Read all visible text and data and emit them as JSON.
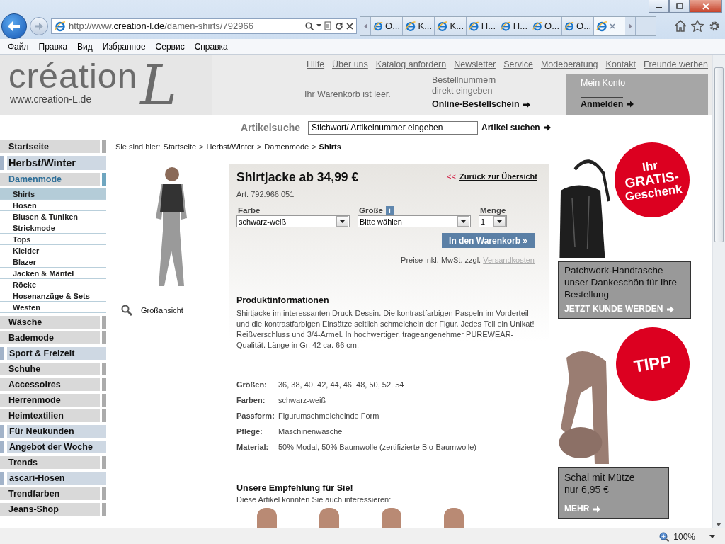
{
  "browser": {
    "url_parts": [
      {
        "text": "http://www.",
        "strong": false
      },
      {
        "text": "creation-l.de",
        "strong": true
      },
      {
        "text": "/damen-shirts/792966",
        "strong": false
      }
    ],
    "tabs": [
      {
        "label": "O...",
        "selected": false
      },
      {
        "label": "K...",
        "selected": false
      },
      {
        "label": "K...",
        "selected": false
      },
      {
        "label": "H...",
        "selected": false
      },
      {
        "label": "H...",
        "selected": false
      },
      {
        "label": "O...",
        "selected": false
      },
      {
        "label": "O...",
        "selected": false
      },
      {
        "selected": true
      }
    ],
    "menu": [
      "Файл",
      "Правка",
      "Вид",
      "Избранное",
      "Сервис",
      "Справка"
    ]
  },
  "header": {
    "logo": {
      "word": "création",
      "letter": "L",
      "url": "www.creation-L.de"
    },
    "links": [
      "Hilfe",
      "Über uns",
      "Katalog anfordern",
      "Newsletter",
      "Service",
      "Modeberatung",
      "Kontakt",
      "Freunde werben"
    ],
    "cart": "Ihr Warenkorb ist leer.",
    "order": {
      "lines": [
        "Bestellnummern",
        "direkt eingeben"
      ],
      "link": "Online-Bestellschein"
    },
    "account": {
      "title": "Mein Konto",
      "link": "Anmelden"
    }
  },
  "search": {
    "label": "Artikelsuche",
    "value": "Stichwort/ Artikelnummer eingeben",
    "button": "Artikel suchen"
  },
  "nav": [
    {
      "label": "Startseite",
      "kind": "main"
    },
    {
      "label": "Herbst/Winter",
      "kind": "season",
      "children": [
        {
          "label": "Damenmode",
          "kind": "category",
          "children": [
            {
              "label": "Shirts",
              "selected": true
            },
            {
              "label": "Hosen",
              "selected": false
            },
            {
              "label": "Blusen & Tuniken",
              "selected": false
            },
            {
              "label": "Strickmode",
              "selected": false
            },
            {
              "label": "Tops",
              "selected": false
            },
            {
              "label": "Kleider",
              "selected": false
            },
            {
              "label": "Blazer",
              "selected": false
            },
            {
              "label": "Jacken & Mäntel",
              "selected": false
            },
            {
              "label": "Röcke",
              "selected": false
            },
            {
              "label": "Hosenanzüge & Sets",
              "selected": false
            },
            {
              "label": "Westen",
              "selected": false
            }
          ]
        }
      ]
    },
    {
      "label": "Wäsche",
      "kind": "main"
    },
    {
      "label": "Bademode",
      "kind": "main"
    },
    {
      "label": "Sport & Freizeit",
      "kind": "promo"
    },
    {
      "label": "Schuhe",
      "kind": "main"
    },
    {
      "label": "Accessoires",
      "kind": "main"
    },
    {
      "label": "Herrenmode",
      "kind": "main"
    },
    {
      "label": "Heimtextilien",
      "kind": "main"
    },
    {
      "label": "Für Neukunden",
      "kind": "promo"
    },
    {
      "label": "Angebot der Woche",
      "kind": "promo"
    },
    {
      "label": "Trends",
      "kind": "main"
    },
    {
      "label": "ascari-Hosen",
      "kind": "promo"
    },
    {
      "label": "Trendfarben",
      "kind": "main"
    },
    {
      "label": "Jeans-Shop",
      "kind": "main"
    }
  ],
  "breadcrumb": {
    "prefix": "Sie sind hier:",
    "separator": ">",
    "items": [
      "Startseite",
      "Herbst/Winter",
      "Damenmode",
      "Shirts"
    ]
  },
  "product": {
    "zoom_link": "Großansicht",
    "title": "Shirtjacke ab 34,99 €",
    "article": "Art. 792.966.051",
    "back_marker": "<<",
    "back_link": "Zurück zur Übersicht",
    "selects": [
      {
        "label": "Farbe",
        "value": "schwarz-weiß",
        "kind": "wide"
      },
      {
        "label": "Größe",
        "info": "i",
        "value": "Bitte wählen",
        "kind": "wide"
      },
      {
        "label": "Menge",
        "value": "1",
        "kind": "narrow"
      }
    ],
    "cart_button": "In den Warenkorb »",
    "price_note": "Preise inkl. MwSt. zzgl.",
    "shipping_link": "Versandkosten",
    "info_title": "Produktinformationen",
    "info_text": "Shirtjacke im interessanten Druck-Dessin. Die kontrastfarbigen Paspeln im Vorderteil und die kontrastfarbigen Einsätze seitlich schmeicheln der Figur. Jedes Teil ein Unikat! Reißverschluss und 3/4-Ärmel. In hochwertiger, trageangenehmer PUREWEAR-Qualität. Länge in Gr. 42 ca. 66 cm.",
    "specs": [
      {
        "label": "Größen:",
        "value": "36,  38,  40,  42,  44,  46,  48,  50,  52,  54"
      },
      {
        "label": "Farben:",
        "value": "schwarz-weiß"
      },
      {
        "label": "Passform:",
        "value": "Figurumschmeichelnde Form"
      },
      {
        "label": "Pflege:",
        "value": "Maschinenwäsche"
      },
      {
        "label": "Material:",
        "value": "50% Modal, 50% Baumwolle (zertifizierte Bio-Baumwolle)"
      }
    ],
    "recommend_title": "Unsere Empfehlung für Sie!",
    "recommend_text": "Diese Artikel könnten Sie auch interessieren:"
  },
  "promos": [
    {
      "kind": "bag",
      "badge_lines": [
        "Ihr",
        "GRATIS-",
        "Geschenk"
      ],
      "caption": "Patchwork-Handtasche – unser Dankeschön für Ihre Bestellung",
      "link": "JETZT KUNDE WERDEN"
    },
    {
      "kind": "scarf",
      "badge_lines": [
        "TIPP"
      ],
      "caption": "Schal mit Mütze nur 6,95 €",
      "link": "MEHR"
    }
  ],
  "status_bar": {
    "zoom": "100%"
  }
}
